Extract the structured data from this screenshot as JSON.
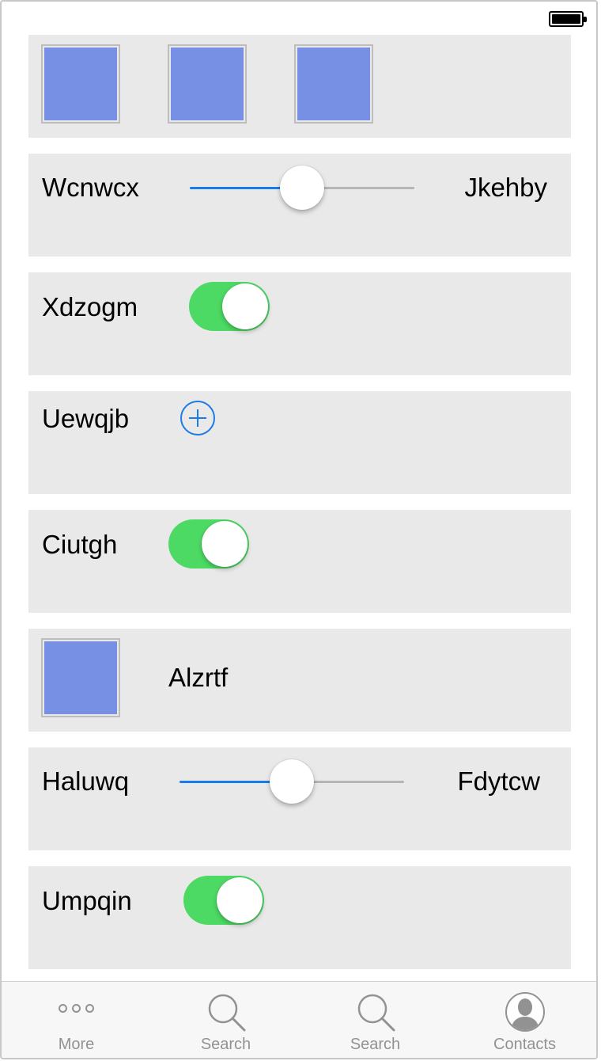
{
  "rows": {
    "slider1": {
      "min_label": "Wcnwcx",
      "max_label": "Jkehby",
      "value": 0.5
    },
    "switch1": {
      "label": "Xdzogm",
      "on": true
    },
    "add_row": {
      "label": "Uewqjb"
    },
    "switch2": {
      "label": "Ciutgh",
      "on": true
    },
    "image_row": {
      "label": "Alzrtf"
    },
    "slider2": {
      "min_label": "Haluwq",
      "max_label": "Fdytcw",
      "value": 0.5
    },
    "switch3": {
      "label": "Umpqin",
      "on": true
    }
  },
  "tabbar": {
    "tabs": [
      {
        "label": "More",
        "icon": "more-icon"
      },
      {
        "label": "Search",
        "icon": "search-icon"
      },
      {
        "label": "Search",
        "icon": "search-icon"
      },
      {
        "label": "Contacts",
        "icon": "contacts-icon"
      }
    ]
  },
  "colors": {
    "accent": "#1a7ce8",
    "switch_on": "#4cd964",
    "image_placeholder": "#7890e3",
    "cell_background": "#e9e9e9",
    "tab_inactive": "#929292"
  }
}
